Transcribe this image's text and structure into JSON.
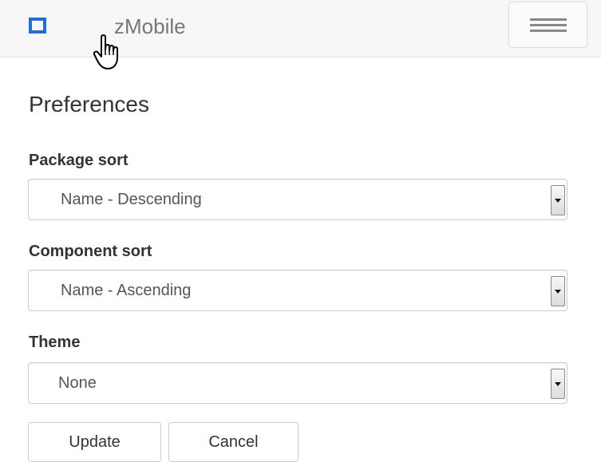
{
  "navbar": {
    "brand": "zMobile",
    "brand_color": "#1e6fd9",
    "logo_icon": "square-logo-icon",
    "menu_icon": "hamburger-menu-icon",
    "cursor_icon": "hand-pointer-cursor-icon"
  },
  "page": {
    "title": "Preferences"
  },
  "form": {
    "package_sort": {
      "label": "Package sort",
      "value": "Name - Descending"
    },
    "component_sort": {
      "label": "Component sort",
      "value": "Name - Ascending"
    },
    "theme": {
      "label": "Theme",
      "value": "None"
    },
    "update_label": "Update",
    "cancel_label": "Cancel"
  }
}
